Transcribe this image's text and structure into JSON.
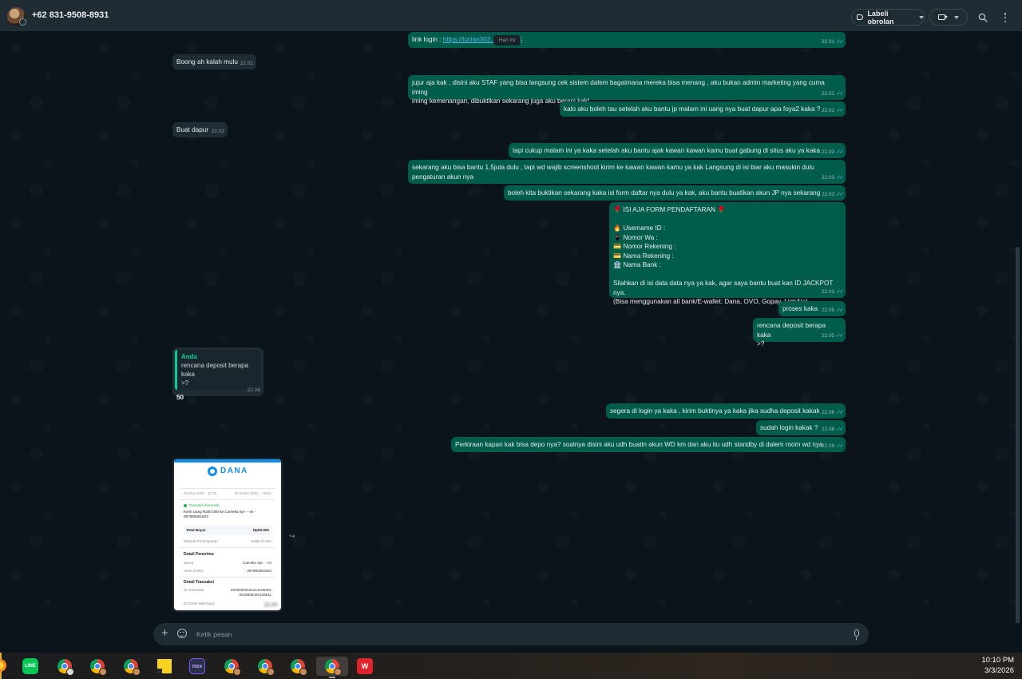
{
  "header": {
    "contact_name": "+62 831-9508-8931",
    "label_button": "Labeli obrolan",
    "icons": [
      "avatar",
      "tag-icon",
      "video-call-icon",
      "search-icon",
      "menu-dots-icon"
    ]
  },
  "chat": {
    "day_separator": "Hari Ini",
    "messages": [
      {
        "dir": "out",
        "prefix": "link login : ",
        "link": "https://lucian303...RGER04",
        "time": "22.01"
      },
      {
        "dir": "in",
        "text": "Boong ah kalah mulu",
        "time": "22.02"
      },
      {
        "dir": "out",
        "text": "jujur aja kak , disini aku STAF yang bisa langsung cek sistem dalem bagaimana mereka bisa menang , aku bukan admin marketing yang cuma iming\niming kemenangan, dibuktikan sekarang juga aku berani kak!",
        "time": "22.02"
      },
      {
        "dir": "out",
        "text": "kalo aku boleh tau setelah aku bantu jp malam ini uang nya buat dapur apa foya2 kaka ?",
        "time": "22.02"
      },
      {
        "dir": "in",
        "text": "Buat dapur",
        "time": "22.02"
      },
      {
        "dir": "out",
        "text": "tapi cukup malam ini ya kaka setelah aku bantu ajak kawan kawan kamu buat gabung di situs aku ya kaka",
        "time": "22.03"
      },
      {
        "dir": "out",
        "text": "sekarang aku bisa bantu 1.5juta dulu , tapi wd wajib screenshoot kirim ke kawan kawan kamu ya kak Langsung di isi biar aku masukin dulu\npengaturan akun nya",
        "time": "22.03"
      },
      {
        "dir": "out",
        "text": "boleh kita buktikan sekarang kaka isi form daftar nya dulu ya kak, aku bantu buatikan akun JP nya sekarang",
        "time": "22.03"
      },
      {
        "dir": "out",
        "text": "🌹 ISI AJA FORM PENDAFTARAN 🌹\n\n🔥 Username ID :\n📱 Nomor Wa :\n💳 Nomor Rekening :\n💳 Nama Rekening :\n🏦 Nama Bank :\n\nSilahkan di isi data data nya ya kak, agar saya bantu buat kan ID JACKPOT nya.\n(Bisa menggunakan all bank/E-wallet: Dana, OVO, Gopay, LinkAja)",
        "time": "22.03"
      },
      {
        "dir": "out",
        "text": "proses kaka",
        "time": "22.05"
      },
      {
        "dir": "out",
        "text": "rencana deposit berapa kaka\n>?",
        "time": "22.05"
      },
      {
        "dir": "in",
        "quote_author": "Anda",
        "quote_text": "rencana deposit berapa kaka\n>?",
        "text": "50",
        "time": "22.06"
      },
      {
        "dir": "out",
        "text": "segera di login ya kaka , kirim buktinya ya kaka jika sudha deposit kakak",
        "time": "22.06"
      },
      {
        "dir": "out",
        "text": "sudah login kakak ?",
        "time": "22.08"
      },
      {
        "dir": "out",
        "text": "Perkiraan kapan kak bisa depo nya? soalnya disini aku udh buatin akun WD km dan aku itu udh standby di dalem room wd nya",
        "time": "22.09"
      }
    ],
    "image_message": {
      "time": "22.09",
      "receipt": {
        "brand": "DANA",
        "date_line": "03 Mar 2026 · 22:08",
        "id_line": "ID DANA 0831····8931",
        "status": "Transaksi berhasil!",
        "desc": "Kirim Uang Rp50.000 ke Camelia Apr····mi -",
        "account": "087890681603",
        "total_label": "Total Bayar",
        "total_value": "Rp50.000",
        "method_label": "Metode Pembayaran",
        "method_value": "Saldo DANA",
        "recipient_head": "Detail Penerima",
        "name_label": "Nama",
        "name_value": "Camelia Apr····mi",
        "acct_label": "Akun DANA",
        "acct_value": "087890681603",
        "tx_head": "Detail Transaksi",
        "tx_label": "ID Transaksi",
        "tx_value1": "20260303101214100301",
        "tx_value2": "0016606420128611",
        "merchant_label": "ID Order Merchant"
      }
    }
  },
  "composer": {
    "placeholder": "Ketik pesan"
  },
  "taskbar": {
    "apps": [
      "line-icon",
      "chrome-icon",
      "chrome-icon",
      "chrome-icon",
      "sticky-notes-icon",
      "nox-icon",
      "chrome-icon",
      "chrome-icon",
      "chrome-icon",
      "chrome-icon",
      "wps-icon"
    ],
    "line_label": "LINE",
    "nox_label": "nox",
    "wps_label": "W",
    "time": "10:10 PM",
    "date": "3/3/2026"
  },
  "colors": {
    "outgoing_bubble": "#005c4b",
    "incoming_bubble": "#202c33",
    "background": "#0b141a",
    "link": "#53bdeb",
    "read_ticks": "#53bdeb",
    "quote_accent": "#06cf9c"
  }
}
